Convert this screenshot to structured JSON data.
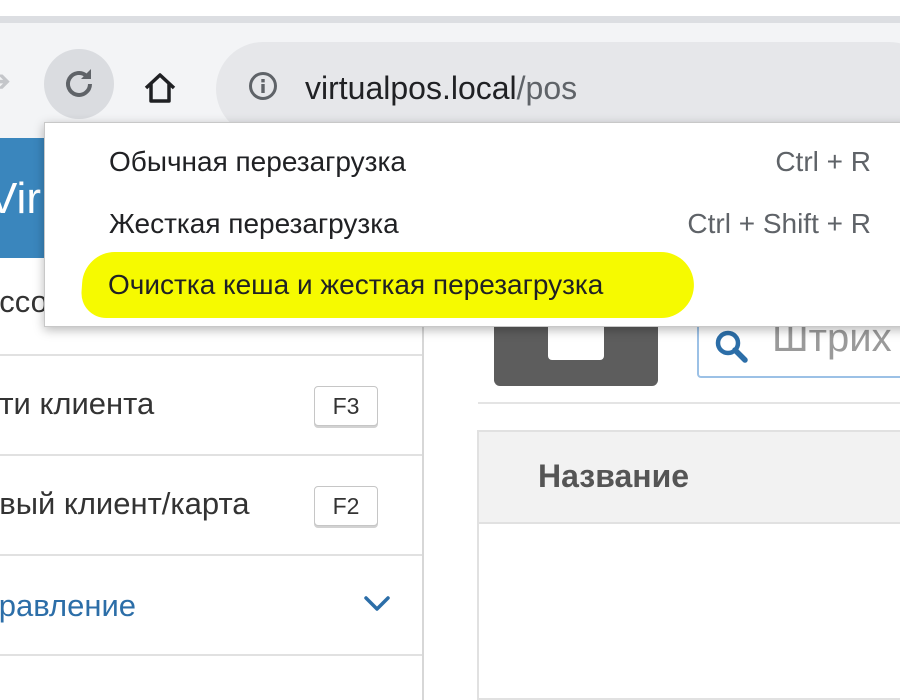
{
  "browser": {
    "url_host": "virtualpos.local",
    "url_path": "/pos",
    "reload_menu": [
      {
        "label": "Обычная перезагрузка",
        "shortcut": "Ctrl + R"
      },
      {
        "label": "Жесткая перезагрузка",
        "shortcut": "Ctrl + Shift + R"
      },
      {
        "label": "Очистка кеша и жесткая перезагрузка",
        "shortcut": ""
      }
    ]
  },
  "sidebar": {
    "brand": "Vir",
    "items": [
      {
        "label": "ассо"
      },
      {
        "label": "йти клиента",
        "key": "F3"
      },
      {
        "label": "овый клиент/карта",
        "key": "F2"
      },
      {
        "label": "правление"
      }
    ]
  },
  "main": {
    "search_placeholder": "Штрих",
    "table_header": "Название"
  },
  "colors": {
    "brand": "#3a86bd",
    "highlight": "#f6fa00",
    "accent_text": "#2c6ea8"
  }
}
